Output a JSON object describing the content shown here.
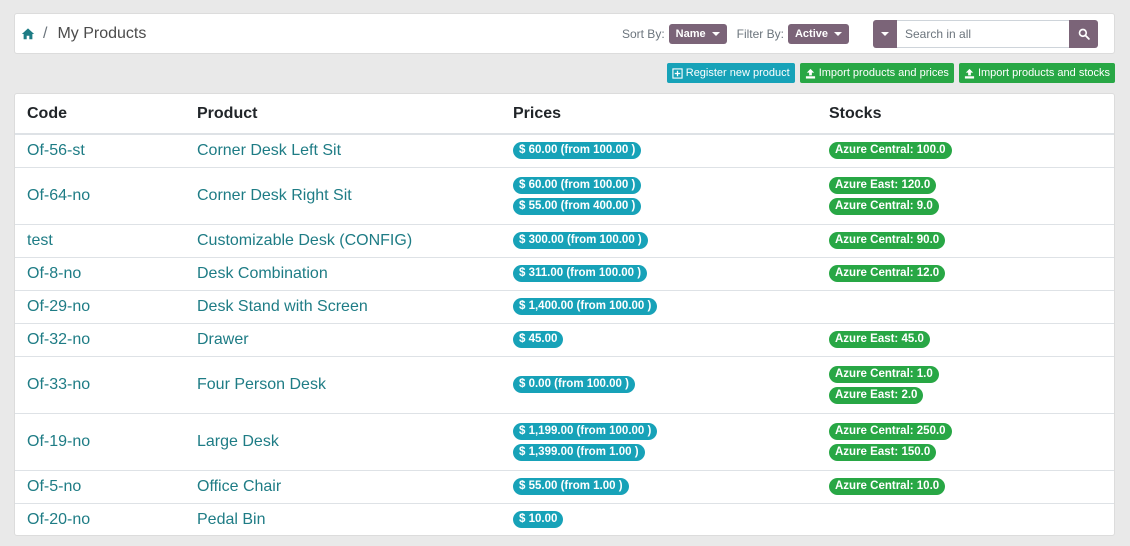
{
  "breadcrumb": {
    "separator": "/",
    "title": "My Products"
  },
  "controls": {
    "sort_label": "Sort By:",
    "sort_value": "Name",
    "filter_label": "Filter By:",
    "filter_value": "Active",
    "search_placeholder": "Search in all"
  },
  "actions": {
    "register": "Register new product",
    "import_prices": "Import products and prices",
    "import_stocks": "Import products and stocks"
  },
  "table": {
    "headers": {
      "code": "Code",
      "product": "Product",
      "prices": "Prices",
      "stocks": "Stocks"
    },
    "rows": [
      {
        "code": "Of-56-st",
        "product": "Corner Desk Left Sit",
        "prices": [
          "$ 60.00 (from 100.00 )"
        ],
        "stocks": [
          "Azure Central: 100.0"
        ]
      },
      {
        "code": "Of-64-no",
        "product": "Corner Desk Right Sit",
        "prices": [
          "$ 60.00 (from 100.00 )",
          "$ 55.00 (from 400.00 )"
        ],
        "stocks": [
          "Azure East: 120.0",
          "Azure Central: 9.0"
        ]
      },
      {
        "code": "test",
        "product": "Customizable Desk (CONFIG)",
        "prices": [
          "$ 300.00 (from 100.00 )"
        ],
        "stocks": [
          "Azure Central: 90.0"
        ]
      },
      {
        "code": "Of-8-no",
        "product": "Desk Combination",
        "prices": [
          "$ 311.00 (from 100.00 )"
        ],
        "stocks": [
          "Azure Central: 12.0"
        ]
      },
      {
        "code": "Of-29-no",
        "product": "Desk Stand with Screen",
        "prices": [
          "$ 1,400.00 (from 100.00 )"
        ],
        "stocks": []
      },
      {
        "code": "Of-32-no",
        "product": "Drawer",
        "prices": [
          "$ 45.00"
        ],
        "stocks": [
          "Azure East: 45.0"
        ]
      },
      {
        "code": "Of-33-no",
        "product": "Four Person Desk",
        "prices": [
          "$ 0.00 (from 100.00 )"
        ],
        "stocks": [
          "Azure Central: 1.0",
          "Azure East: 2.0"
        ]
      },
      {
        "code": "Of-19-no",
        "product": "Large Desk",
        "prices": [
          "$ 1,199.00 (from 100.00 )",
          "$ 1,399.00 (from 1.00 )"
        ],
        "stocks": [
          "Azure Central: 250.0",
          "Azure East: 150.0"
        ]
      },
      {
        "code": "Of-5-no",
        "product": "Office Chair",
        "prices": [
          "$ 55.00 (from 1.00 )"
        ],
        "stocks": [
          "Azure Central: 10.0"
        ]
      },
      {
        "code": "Of-20-no",
        "product": "Pedal Bin",
        "prices": [
          "$ 10.00"
        ],
        "stocks": []
      }
    ]
  },
  "colors": {
    "accent": "#7b6478",
    "link": "#1e7c85",
    "info": "#17a2b8",
    "success": "#28a745"
  },
  "icons": {
    "home": "home-icon",
    "search": "search-icon",
    "register": "plus-square-icon",
    "import": "upload-icon"
  }
}
